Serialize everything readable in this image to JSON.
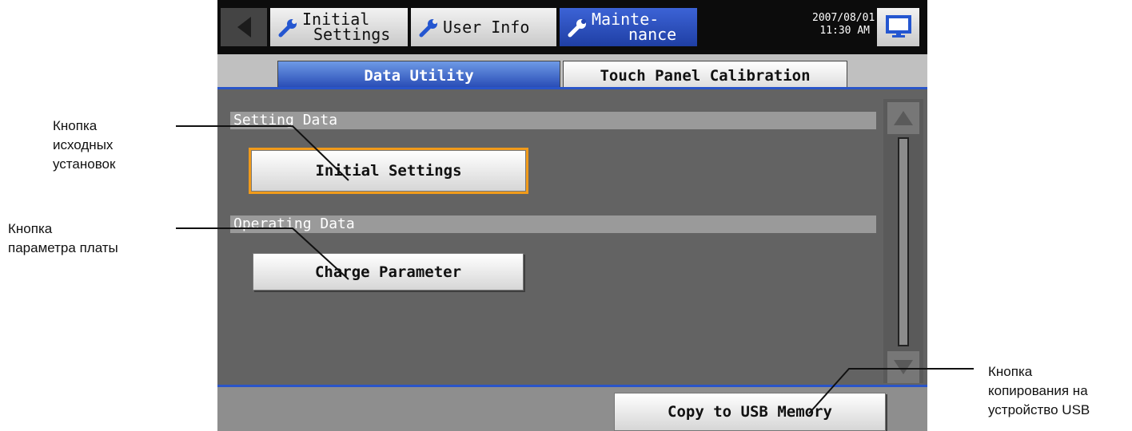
{
  "callouts": {
    "initial_settings": [
      "Кнопка",
      "исходных",
      "установок"
    ],
    "charge_parameter": [
      "Кнопка",
      "параметра платы"
    ],
    "copy_usb": [
      "Кнопка",
      "копирования на",
      "устройство USB"
    ]
  },
  "header": {
    "tabs": [
      {
        "label_line1": "Initial",
        "label_line2": "Settings",
        "icon": "wrench-icon"
      },
      {
        "label_line1": "User Info",
        "label_line2": "",
        "icon": "wrench-icon"
      },
      {
        "label_line1": "Mainte-",
        "label_line2": "nance",
        "icon": "wrench-icon",
        "active": true
      }
    ],
    "date": "2007/08/01",
    "time": "11:30 AM",
    "back_icon": "left-arrow-icon",
    "monitor_icon": "monitor-icon"
  },
  "subtabs": {
    "active": "Data Utility",
    "other": "Touch Panel Calibration"
  },
  "sections": {
    "setting_data": {
      "title": "Setting Data",
      "button": "Initial Settings"
    },
    "operating_data": {
      "title": "Operating Data",
      "button": "Charge Parameter"
    }
  },
  "footer": {
    "copy_button": "Copy to USB Memory"
  },
  "colors": {
    "active_tab": "#2346b2",
    "highlight": "#f19b1b",
    "panel_bg": "#636363",
    "section_bar": "#9a9a9a",
    "accent_rule": "#2a55c8"
  }
}
